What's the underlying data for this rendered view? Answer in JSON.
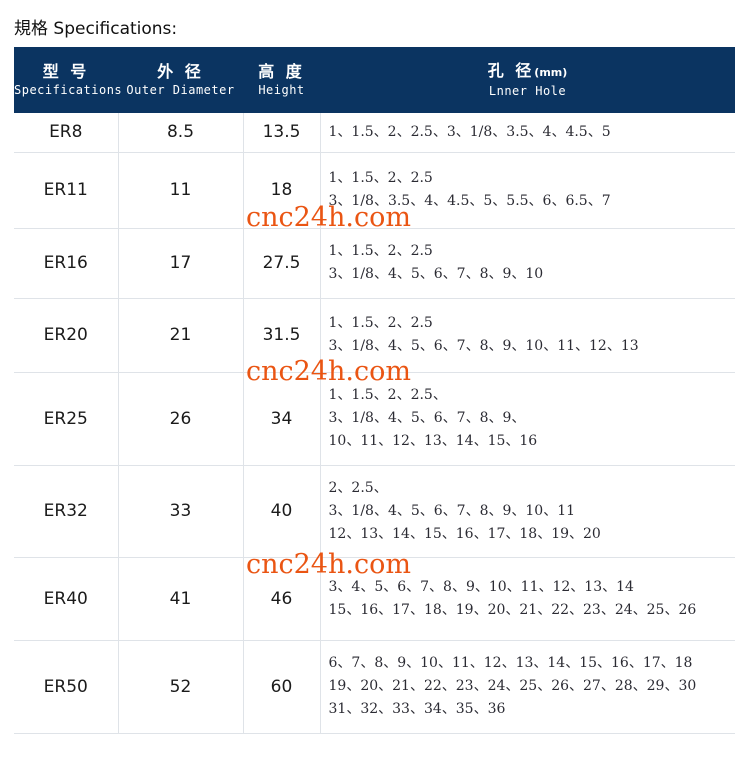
{
  "page": {
    "title": "規格 Specifications:",
    "header_bg": "#0b3461",
    "watermark_color": "#ea5513",
    "grid_color": "#dfe3e8"
  },
  "watermarks": [
    {
      "text": "cnc24h.com"
    },
    {
      "text": "cnc24h.com"
    },
    {
      "text": "cnc24h.com"
    }
  ],
  "table": {
    "columns": [
      {
        "cn": "型  号",
        "en": "Specifications",
        "unit": ""
      },
      {
        "cn": "外 径",
        "en": "Outer Diameter",
        "unit": ""
      },
      {
        "cn": "高 度",
        "en": "Height",
        "unit": ""
      },
      {
        "cn": "孔 径",
        "en": "Lnner Hole",
        "unit": "(mm)"
      }
    ],
    "rows": [
      {
        "model": "ER8",
        "outer_diameter": "8.5",
        "height": "13.5",
        "hole_lines": [
          "1、1.5、2、2.5、3、1/8、3.5、4、4.5、5"
        ]
      },
      {
        "model": "ER11",
        "outer_diameter": "11",
        "height": "18",
        "hole_lines": [
          "1、1.5、2、2.5",
          "3、1/8、3.5、4、4.5、5、5.5、6、6.5、7"
        ]
      },
      {
        "model": "ER16",
        "outer_diameter": "17",
        "height": "27.5",
        "hole_lines": [
          "1、1.5、2、2.5",
          "3、1/8、4、5、6、7、8、9、10"
        ]
      },
      {
        "model": "ER20",
        "outer_diameter": "21",
        "height": "31.5",
        "hole_lines": [
          "1、1.5、2、2.5",
          "3、1/8、4、5、6、7、8、9、10、11、12、13"
        ]
      },
      {
        "model": "ER25",
        "outer_diameter": "26",
        "height": "34",
        "hole_lines": [
          "1、1.5、2、2.5、",
          "3、1/8、4、5、6、7、8、9、",
          "10、11、12、13、14、15、16"
        ]
      },
      {
        "model": "ER32",
        "outer_diameter": "33",
        "height": "40",
        "hole_lines": [
          "2、2.5、",
          "3、1/8、4、5、6、7、8、9、10、11",
          "12、13、14、15、16、17、18、19、20"
        ]
      },
      {
        "model": "ER40",
        "outer_diameter": "41",
        "height": "46",
        "hole_lines": [
          "3、4、5、6、7、8、9、10、11、12、13、14",
          "15、16、17、18、19、20、21、22、23、24、25、26"
        ]
      },
      {
        "model": "ER50",
        "outer_diameter": "52",
        "height": "60",
        "hole_lines": [
          "6、7、8、9、10、11、12、13、14、15、16、17、18",
          "19、20、21、22、23、24、25、26、27、28、29、30",
          "31、32、33、34、35、36"
        ]
      }
    ]
  }
}
